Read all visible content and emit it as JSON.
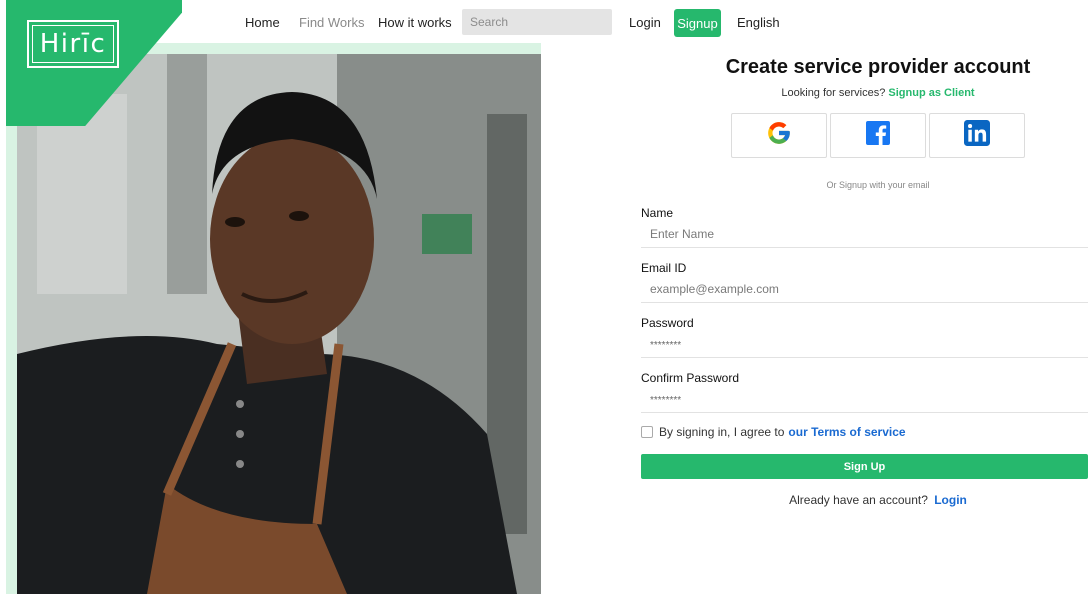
{
  "brand": {
    "logo_text": "Hirīc",
    "accent": "#26b86d"
  },
  "nav": {
    "home": "Home",
    "find_works": "Find Works",
    "how_it_works": "How it works",
    "search_placeholder": "Search",
    "login": "Login",
    "signup": "Signup",
    "language": "English"
  },
  "hero": {
    "image": "service-provider-photo"
  },
  "form": {
    "title": "Create service provider account",
    "subtitle_prefix": "Looking for services?",
    "subtitle_link": "Signup as Client",
    "social": [
      "google-icon",
      "facebook-icon",
      "linkedin-icon"
    ],
    "or_text": "Or Signup with your email",
    "name_label": "Name",
    "name_placeholder": "Enter Name",
    "email_label": "Email ID",
    "email_placeholder": "example@example.com",
    "password_label": "Password",
    "password_placeholder": "********",
    "confirm_label": "Confirm Password",
    "confirm_placeholder": "********",
    "terms_prefix": "By signing in, I agree to",
    "terms_link": "our Terms of service",
    "submit": "Sign Up",
    "already_prefix": "Already have an account?",
    "already_link": "Login"
  }
}
